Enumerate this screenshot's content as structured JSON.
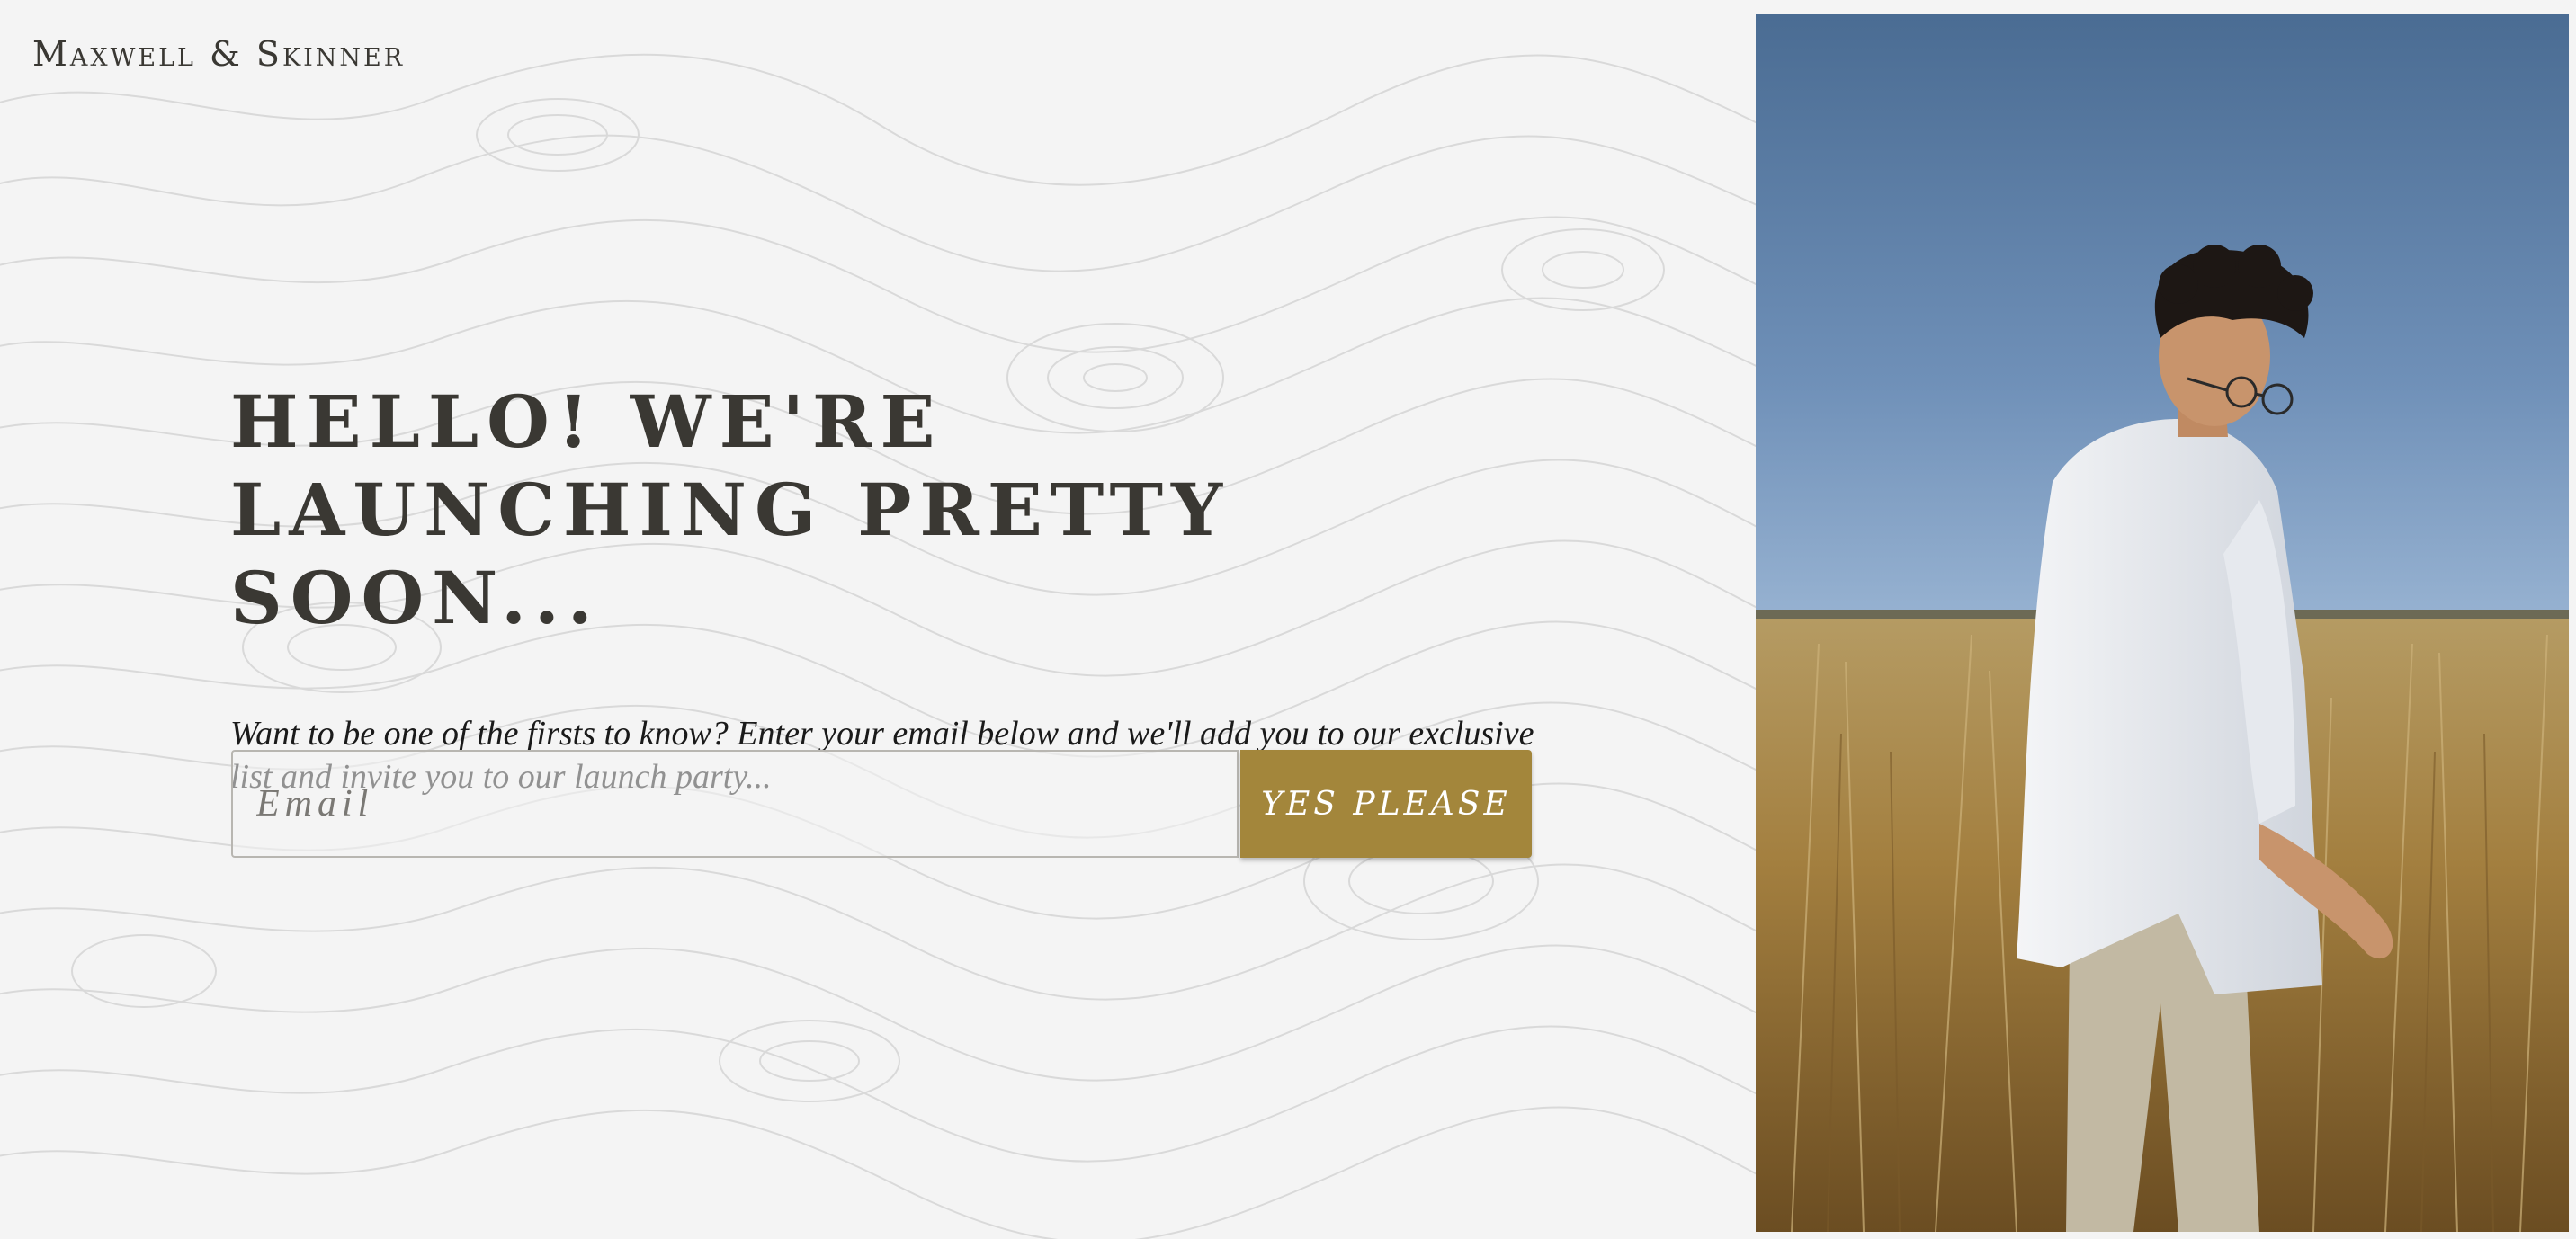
{
  "brand": {
    "name": "Maxwell & Skinner"
  },
  "hero": {
    "title": "Hello! We're launching pretty soon...",
    "subtitle": "Want to be one of the firsts to know? Enter your email below and we'll add you to our exclusive list and invite you to our launch party..."
  },
  "form": {
    "email_placeholder": "Email",
    "email_value": "",
    "submit_label": "Yes Please"
  },
  "colors": {
    "accent": "#a3863b",
    "text_dark": "#3a3833",
    "background": "#f4f4f4"
  },
  "photo": {
    "alt": "Man in white shirt walking through golden tall grass field under blue sky"
  }
}
